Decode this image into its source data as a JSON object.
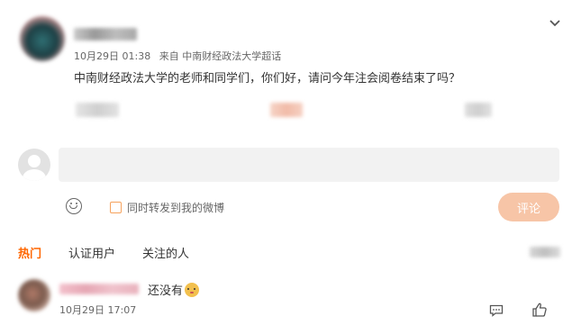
{
  "post": {
    "meta_time": "10月29日 01:38",
    "meta_source": "来自 中南财经政法大学超话",
    "text": "中南财经政法大学的老师和同学们，你们好，请问今年注会阅卷结束了吗？"
  },
  "composer": {
    "forward_label": "同时转发到我的微博",
    "submit_label": "评论"
  },
  "tabs": [
    {
      "label": "热门",
      "active": true
    },
    {
      "label": "认证用户",
      "active": false
    },
    {
      "label": "关注的人",
      "active": false
    }
  ],
  "comment": {
    "text": "还没有",
    "time": "10月29日 17:07"
  },
  "colors": {
    "accent": "#ff6600",
    "submit_bg": "#f7c5a7",
    "input_bg": "#f2f2f2"
  },
  "icons": {
    "collapse": "chevron-down-icon",
    "emoji": "smiley-icon",
    "reply": "reply-icon",
    "like": "thumbs-up-icon"
  }
}
